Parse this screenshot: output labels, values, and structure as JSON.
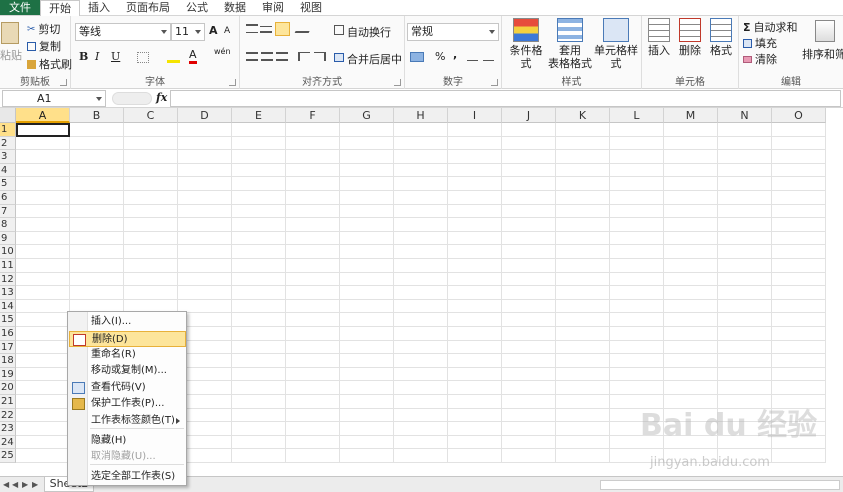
{
  "tabs": [
    "文件",
    "开始",
    "插入",
    "页面布局",
    "公式",
    "数据",
    "审阅",
    "视图"
  ],
  "clipboard": {
    "paste": "粘贴",
    "cut": "剪切",
    "copy": "复制",
    "format_painter": "格式刷",
    "label": "剪贴板"
  },
  "font": {
    "name": "等线",
    "size": "11",
    "bold": "B",
    "italic": "I",
    "underline": "U",
    "grow": "A",
    "shrink": "A",
    "color_a": "A",
    "label": "字体",
    "wen": "wén"
  },
  "align": {
    "wrap": "自动换行",
    "merge": "合并后居中",
    "label": "对齐方式"
  },
  "number": {
    "format": "常规",
    "percent": "%",
    "comma": ",",
    "label": "数字"
  },
  "styles": {
    "conditional": "条件格式",
    "table_line1": "套用",
    "table_line2": "表格格式",
    "cell_styles": "单元格样式",
    "label": "样式"
  },
  "cells": {
    "insert": "插入",
    "delete": "删除",
    "format": "格式",
    "label": "单元格"
  },
  "editing": {
    "sigma": "Σ",
    "autosum": "自动求和",
    "fill": "填充",
    "clear": "清除",
    "sort": "排序和筛选",
    "label": "编辑"
  },
  "formula_bar": {
    "name_box": "A1",
    "fx": "fx"
  },
  "columns": [
    "A",
    "B",
    "C",
    "D",
    "E",
    "F",
    "G",
    "H",
    "I",
    "J",
    "K",
    "L",
    "M",
    "N",
    "O"
  ],
  "rows": [
    "1",
    "2",
    "3",
    "4",
    "5",
    "6",
    "7",
    "8",
    "9",
    "10",
    "11",
    "12",
    "13",
    "14",
    "15",
    "16",
    "17",
    "18",
    "19",
    "20",
    "21",
    "22",
    "23",
    "24",
    "25"
  ],
  "sheet": {
    "name": "Sheet2"
  },
  "context_menu": [
    {
      "label": "插入(I)...",
      "icon": "",
      "disabled": false,
      "highlight": false,
      "arrow": false
    },
    {
      "label": "删除(D)",
      "icon": "delete-sheet-icon",
      "disabled": false,
      "highlight": true,
      "arrow": false
    },
    {
      "label": "重命名(R)",
      "icon": "",
      "disabled": false,
      "highlight": false,
      "arrow": false
    },
    {
      "label": "移动或复制(M)...",
      "icon": "",
      "disabled": false,
      "highlight": false,
      "arrow": false
    },
    {
      "label": "查看代码(V)",
      "icon": "view-code-icon",
      "disabled": false,
      "highlight": false,
      "arrow": false
    },
    {
      "label": "保护工作表(P)...",
      "icon": "protect-sheet-icon",
      "disabled": false,
      "highlight": false,
      "arrow": false
    },
    {
      "label": "工作表标签颜色(T)",
      "icon": "",
      "disabled": false,
      "highlight": false,
      "arrow": true
    },
    {
      "label": "隐藏(H)",
      "icon": "",
      "disabled": false,
      "highlight": false,
      "arrow": false
    },
    {
      "label": "取消隐藏(U)...",
      "icon": "",
      "disabled": true,
      "highlight": false,
      "arrow": false
    },
    {
      "label": "选定全部工作表(S)",
      "icon": "",
      "disabled": false,
      "highlight": false,
      "arrow": false
    }
  ],
  "watermark": {
    "brand": "Bai du 经验",
    "url": "jingyan.baidu.com"
  },
  "colors": {
    "file_tab": "#1e7145",
    "selection": "#ffe08a",
    "menu_highlight": "#fde59b"
  }
}
